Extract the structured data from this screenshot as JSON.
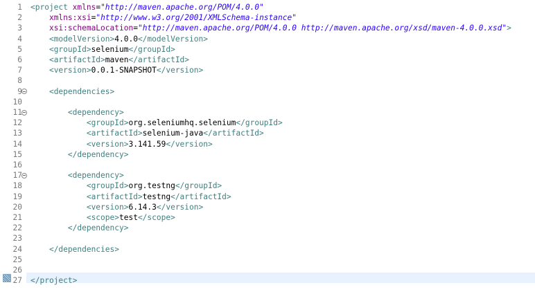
{
  "editor": {
    "lines": [
      {
        "n": "1",
        "fold": false,
        "segs": [
          {
            "c": "tag",
            "t": "<project "
          },
          {
            "c": "attr",
            "t": "xmlns"
          },
          {
            "c": "eq",
            "t": "="
          },
          {
            "c": "val",
            "t": "\"http://maven.apache.org/POM/4.0.0\""
          }
        ]
      },
      {
        "n": "2",
        "fold": false,
        "segs": [
          {
            "c": "txt",
            "t": "    "
          },
          {
            "c": "attr",
            "t": "xmlns:xsi"
          },
          {
            "c": "eq",
            "t": "="
          },
          {
            "c": "val",
            "t": "\"http://www.w3.org/2001/XMLSchema-instance\""
          }
        ]
      },
      {
        "n": "3",
        "fold": false,
        "segs": [
          {
            "c": "txt",
            "t": "    "
          },
          {
            "c": "attr",
            "t": "xsi:schemaLocation"
          },
          {
            "c": "eq",
            "t": "="
          },
          {
            "c": "val",
            "t": "\"http://maven.apache.org/POM/4.0.0 http://maven.apache.org/xsd/maven-4.0.0.xsd\""
          },
          {
            "c": "tag",
            "t": ">"
          }
        ]
      },
      {
        "n": "4",
        "fold": false,
        "segs": [
          {
            "c": "txt",
            "t": "    "
          },
          {
            "c": "tag",
            "t": "<modelVersion>"
          },
          {
            "c": "txt",
            "t": "4.0.0"
          },
          {
            "c": "tag",
            "t": "</modelVersion>"
          }
        ]
      },
      {
        "n": "5",
        "fold": false,
        "segs": [
          {
            "c": "txt",
            "t": "    "
          },
          {
            "c": "tag",
            "t": "<groupId>"
          },
          {
            "c": "txt",
            "t": "selenium"
          },
          {
            "c": "tag",
            "t": "</groupId>"
          }
        ]
      },
      {
        "n": "6",
        "fold": false,
        "segs": [
          {
            "c": "txt",
            "t": "    "
          },
          {
            "c": "tag",
            "t": "<artifactId>"
          },
          {
            "c": "txt",
            "t": "maven"
          },
          {
            "c": "tag",
            "t": "</artifactId>"
          }
        ]
      },
      {
        "n": "7",
        "fold": false,
        "segs": [
          {
            "c": "txt",
            "t": "    "
          },
          {
            "c": "tag",
            "t": "<version>"
          },
          {
            "c": "txt",
            "t": "0.0.1-SNAPSHOT"
          },
          {
            "c": "tag",
            "t": "</version>"
          }
        ]
      },
      {
        "n": "8",
        "fold": false,
        "segs": []
      },
      {
        "n": "9",
        "fold": true,
        "segs": [
          {
            "c": "txt",
            "t": "    "
          },
          {
            "c": "tag",
            "t": "<dependencies>"
          }
        ]
      },
      {
        "n": "10",
        "fold": false,
        "segs": []
      },
      {
        "n": "11",
        "fold": true,
        "segs": [
          {
            "c": "txt",
            "t": "        "
          },
          {
            "c": "tag",
            "t": "<dependency>"
          }
        ]
      },
      {
        "n": "12",
        "fold": false,
        "segs": [
          {
            "c": "txt",
            "t": "            "
          },
          {
            "c": "tag",
            "t": "<groupId>"
          },
          {
            "c": "txt",
            "t": "org.seleniumhq.selenium"
          },
          {
            "c": "tag",
            "t": "</groupId>"
          }
        ]
      },
      {
        "n": "13",
        "fold": false,
        "segs": [
          {
            "c": "txt",
            "t": "            "
          },
          {
            "c": "tag",
            "t": "<artifactId>"
          },
          {
            "c": "txt",
            "t": "selenium-java"
          },
          {
            "c": "tag",
            "t": "</artifactId>"
          }
        ]
      },
      {
        "n": "14",
        "fold": false,
        "segs": [
          {
            "c": "txt",
            "t": "            "
          },
          {
            "c": "tag",
            "t": "<version>"
          },
          {
            "c": "txt",
            "t": "3.141.59"
          },
          {
            "c": "tag",
            "t": "</version>"
          }
        ]
      },
      {
        "n": "15",
        "fold": false,
        "segs": [
          {
            "c": "txt",
            "t": "        "
          },
          {
            "c": "tag",
            "t": "</dependency>"
          }
        ]
      },
      {
        "n": "16",
        "fold": false,
        "segs": []
      },
      {
        "n": "17",
        "fold": true,
        "segs": [
          {
            "c": "txt",
            "t": "        "
          },
          {
            "c": "tag",
            "t": "<dependency>"
          }
        ]
      },
      {
        "n": "18",
        "fold": false,
        "segs": [
          {
            "c": "txt",
            "t": "            "
          },
          {
            "c": "tag",
            "t": "<groupId>"
          },
          {
            "c": "txt",
            "t": "org.testng"
          },
          {
            "c": "tag",
            "t": "</groupId>"
          }
        ]
      },
      {
        "n": "19",
        "fold": false,
        "segs": [
          {
            "c": "txt",
            "t": "            "
          },
          {
            "c": "tag",
            "t": "<artifactId>"
          },
          {
            "c": "txt",
            "t": "testng"
          },
          {
            "c": "tag",
            "t": "</artifactId>"
          }
        ]
      },
      {
        "n": "20",
        "fold": false,
        "segs": [
          {
            "c": "txt",
            "t": "            "
          },
          {
            "c": "tag",
            "t": "<version>"
          },
          {
            "c": "txt",
            "t": "6.14.3"
          },
          {
            "c": "tag",
            "t": "</version>"
          }
        ]
      },
      {
        "n": "21",
        "fold": false,
        "segs": [
          {
            "c": "txt",
            "t": "            "
          },
          {
            "c": "tag",
            "t": "<scope>"
          },
          {
            "c": "txt",
            "t": "test"
          },
          {
            "c": "tag",
            "t": "</scope>"
          }
        ]
      },
      {
        "n": "22",
        "fold": false,
        "segs": [
          {
            "c": "txt",
            "t": "        "
          },
          {
            "c": "tag",
            "t": "</dependency>"
          }
        ]
      },
      {
        "n": "23",
        "fold": false,
        "segs": []
      },
      {
        "n": "24",
        "fold": false,
        "segs": [
          {
            "c": "txt",
            "t": "    "
          },
          {
            "c": "tag",
            "t": "</dependencies>"
          }
        ]
      },
      {
        "n": "25",
        "fold": false,
        "segs": []
      },
      {
        "n": "26",
        "fold": false,
        "segs": []
      },
      {
        "n": "27",
        "fold": false,
        "segs": [
          {
            "c": "tag",
            "t": "</project>"
          }
        ]
      }
    ],
    "colors": {
      "tag": "#3f7f7f",
      "attr": "#7f007f",
      "value": "#2a00ff",
      "text": "#000000",
      "line_number": "#787878",
      "current_line": "#e8f2fe"
    },
    "bookmark_icon": "bookmark-icon",
    "fold_icon": "collapse-icon"
  }
}
